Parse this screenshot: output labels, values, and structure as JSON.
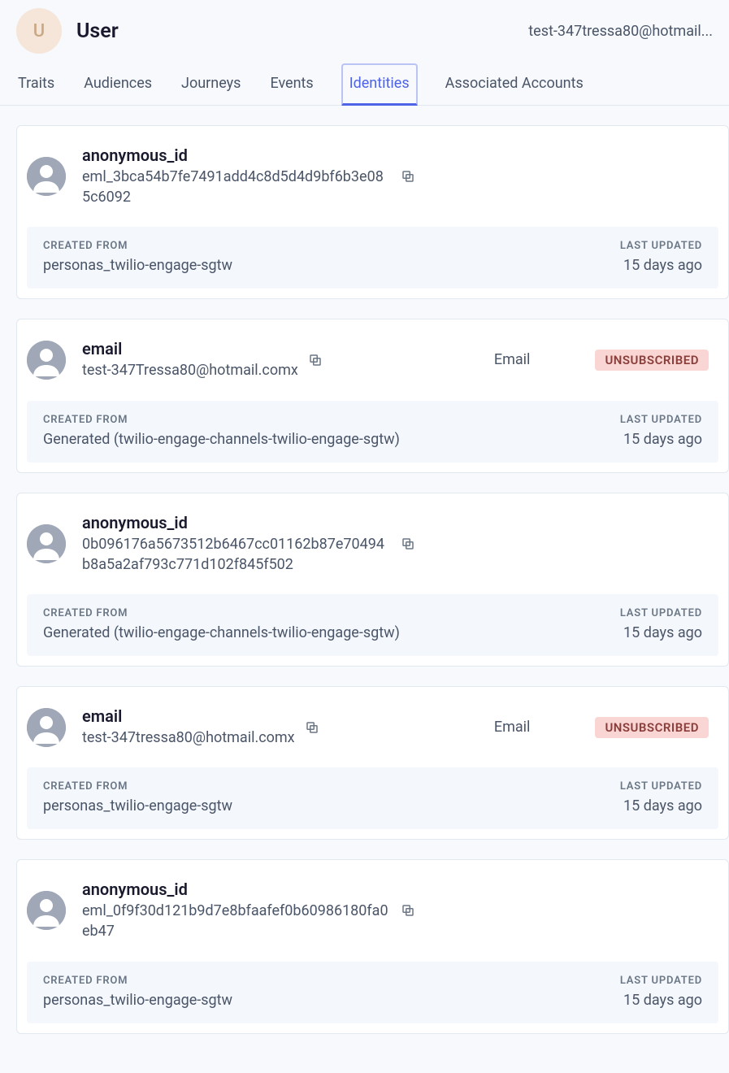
{
  "header": {
    "avatar_letter": "U",
    "title": "User",
    "email": "test-347tressa80@hotmail..."
  },
  "tabs": [
    {
      "label": "Traits",
      "active": false
    },
    {
      "label": "Audiences",
      "active": false
    },
    {
      "label": "Journeys",
      "active": false
    },
    {
      "label": "Events",
      "active": false
    },
    {
      "label": "Identities",
      "active": true
    },
    {
      "label": "Associated Accounts",
      "active": false
    }
  ],
  "labels": {
    "created_from": "CREATED FROM",
    "last_updated": "LAST UPDATED"
  },
  "identities": [
    {
      "type": "anonymous_id",
      "value": "eml_3bca54b7fe7491add4c8d5d4d9bf6b3e085c6092",
      "channel": null,
      "badge": null,
      "created_from": "personas_twilio-engage-sgtw",
      "last_updated": "15 days ago"
    },
    {
      "type": "email",
      "value": "test-347Tressa80@hotmail.comx",
      "channel": "Email",
      "badge": "UNSUBSCRIBED",
      "created_from": "Generated (twilio-engage-channels-twilio-engage-sgtw)",
      "last_updated": "15 days ago"
    },
    {
      "type": "anonymous_id",
      "value": "0b096176a5673512b6467cc01162b87e70494b8a5a2af793c771d102f845f502",
      "channel": null,
      "badge": null,
      "created_from": "Generated (twilio-engage-channels-twilio-engage-sgtw)",
      "last_updated": "15 days ago"
    },
    {
      "type": "email",
      "value": "test-347tressa80@hotmail.comx",
      "channel": "Email",
      "badge": "UNSUBSCRIBED",
      "created_from": "personas_twilio-engage-sgtw",
      "last_updated": "15 days ago"
    },
    {
      "type": "anonymous_id",
      "value": "eml_0f9f30d121b9d7e8bfaafef0b60986180fa0eb47",
      "channel": null,
      "badge": null,
      "created_from": "personas_twilio-engage-sgtw",
      "last_updated": "15 days ago"
    }
  ]
}
